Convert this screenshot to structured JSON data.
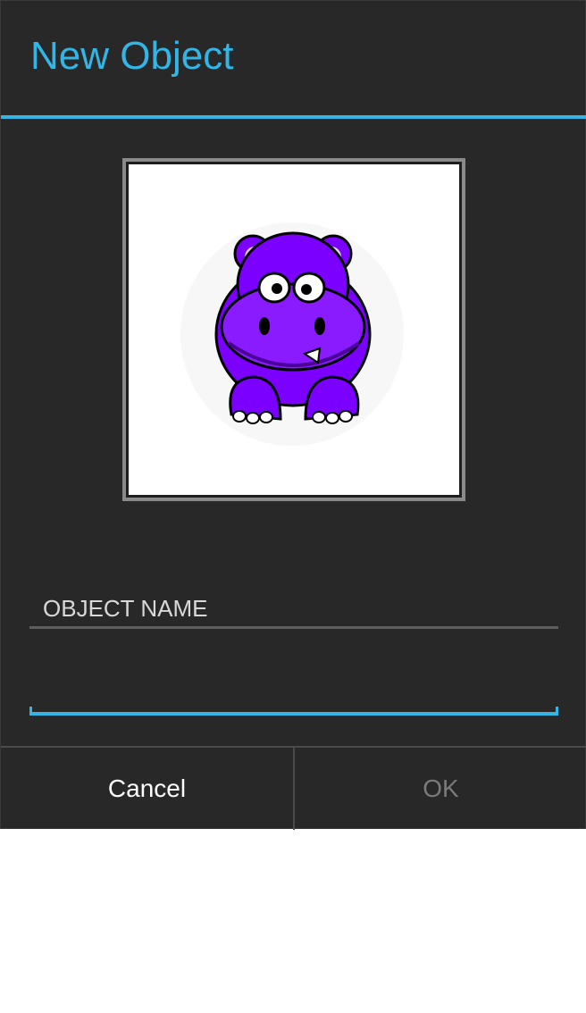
{
  "dialog": {
    "title": "New Object",
    "image_alt": "purple hippo"
  },
  "form": {
    "section_label": "OBJECT NAME",
    "name_value": "",
    "name_placeholder": ""
  },
  "buttons": {
    "cancel_label": "Cancel",
    "ok_label": "OK"
  },
  "colors": {
    "accent": "#33b5e5",
    "background": "#282828",
    "hippo": "#7b00ff",
    "disabled_text": "#7a7a7a"
  }
}
